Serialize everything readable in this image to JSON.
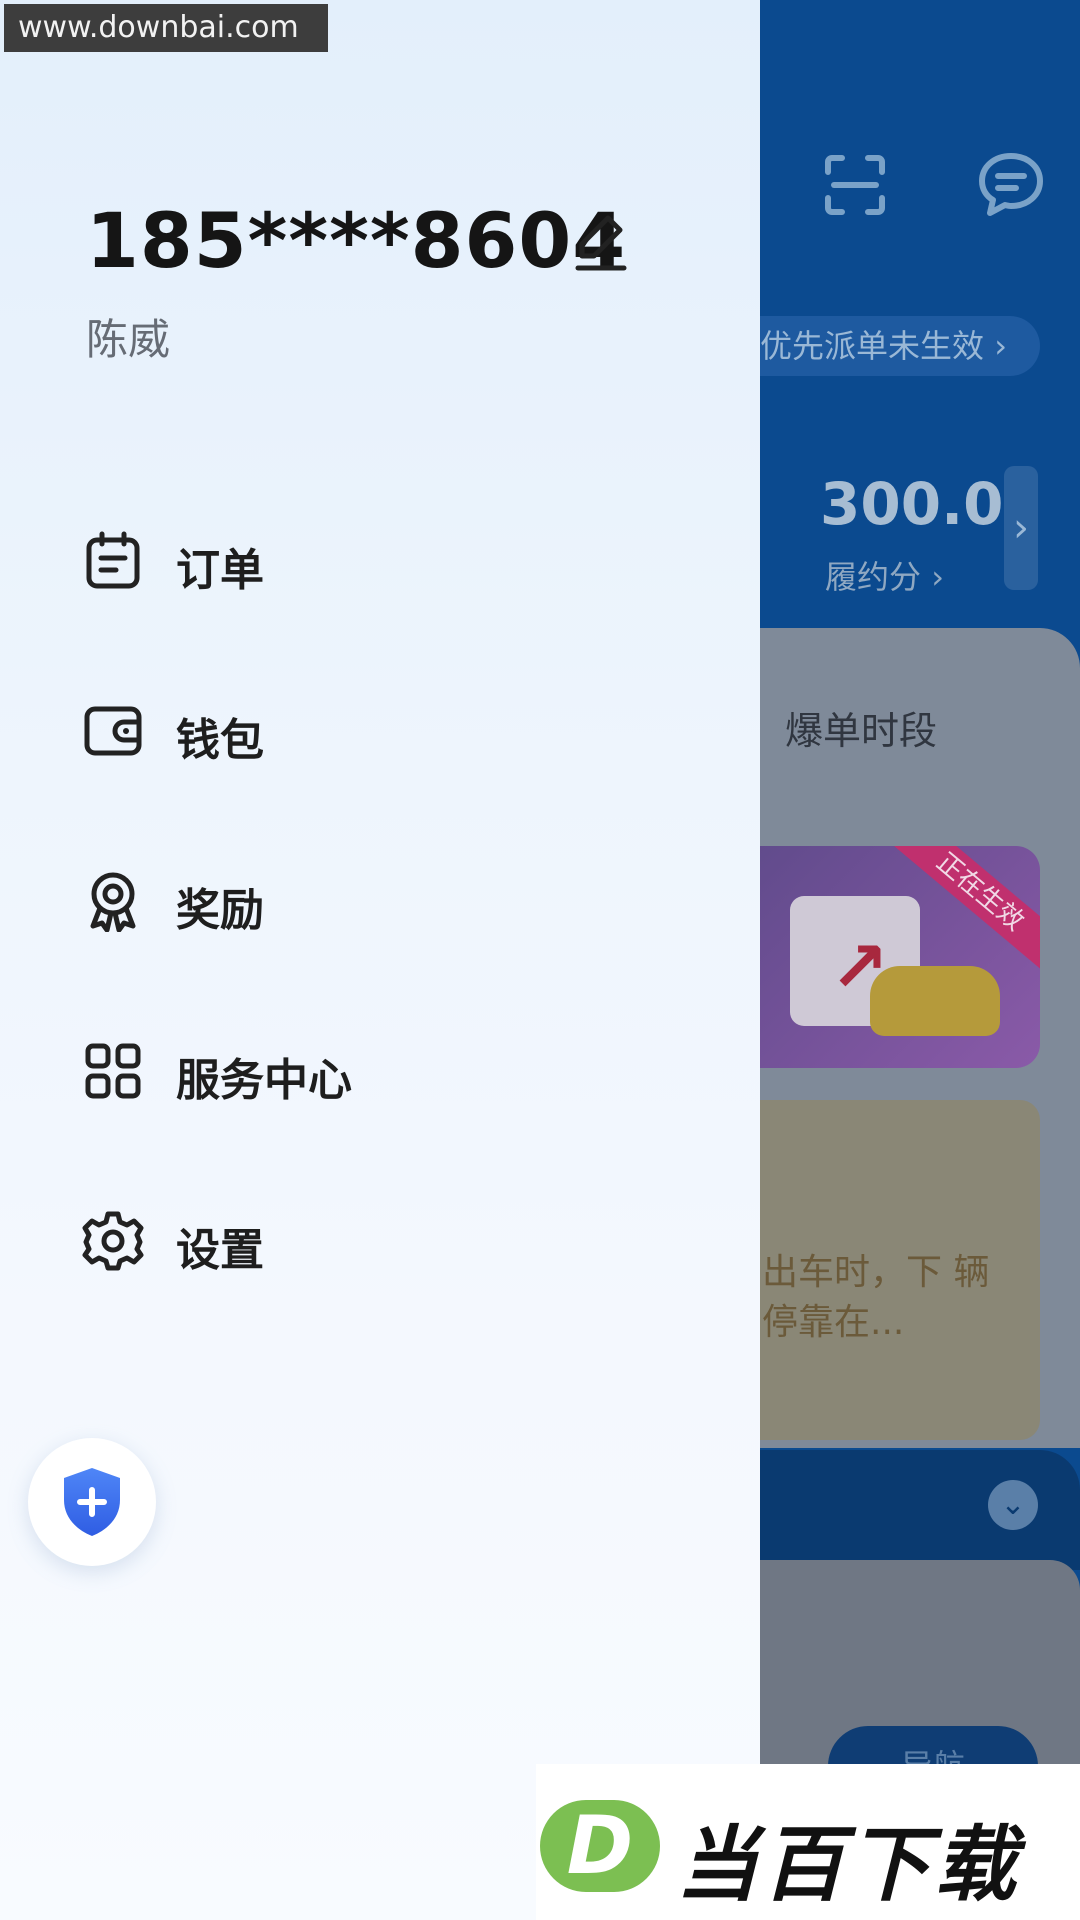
{
  "watermark_top": "www.downbai.com",
  "watermark_bottom": {
    "logo_letter": "D",
    "text": "当百下载"
  },
  "drawer": {
    "phone": "185****8604",
    "name": "陈威",
    "menu": [
      {
        "label": "订单",
        "icon": "order-list-icon"
      },
      {
        "label": "钱包",
        "icon": "wallet-icon"
      },
      {
        "label": "奖励",
        "icon": "reward-medal-icon"
      },
      {
        "label": "服务中心",
        "icon": "grid-apps-icon"
      },
      {
        "label": "设置",
        "icon": "gear-icon"
      }
    ],
    "safety_icon": "shield-plus-icon"
  },
  "background": {
    "priority_pill": "优先派单未生效",
    "score_value": "300.0",
    "score_label": "履约分",
    "card_title": "爆单时段",
    "banner_badge": "正在生效",
    "notice_text": "出车时，下 辆停靠在...",
    "nav_button": "导航"
  },
  "colors": {
    "drawer_top": "#e3effb",
    "drawer_bottom": "#f8fbff",
    "primary_text": "#1e1e1e",
    "secondary_text": "#666c75",
    "shield_blue": "#3b6cf0",
    "bg_blue": "#0b4a8f"
  }
}
